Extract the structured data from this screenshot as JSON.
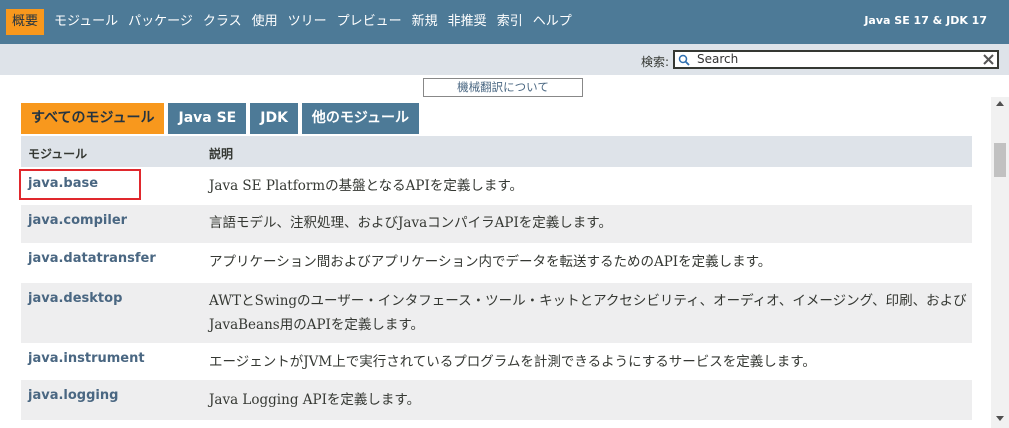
{
  "top_nav": {
    "items": [
      {
        "label": "概要",
        "active": true
      },
      {
        "label": "モジュール"
      },
      {
        "label": "パッケージ"
      },
      {
        "label": "クラス"
      },
      {
        "label": "使用"
      },
      {
        "label": "ツリー"
      },
      {
        "label": "プレビュー"
      },
      {
        "label": "新規"
      },
      {
        "label": "非推奨"
      },
      {
        "label": "索引"
      },
      {
        "label": "ヘルプ"
      }
    ],
    "version": "Java SE 17 & JDK 17"
  },
  "search": {
    "label": "検索:",
    "placeholder": "Search"
  },
  "translation_link": "機械翻訳について",
  "tabs": [
    {
      "label": "すべてのモジュール",
      "active": true
    },
    {
      "label": "Java SE"
    },
    {
      "label": "JDK"
    },
    {
      "label": "他のモジュール"
    }
  ],
  "table": {
    "headers": {
      "module": "モジュール",
      "description": "説明"
    },
    "rows": [
      {
        "module": "java.base",
        "description": "Java SE Platformの基盤となるAPIを定義します。"
      },
      {
        "module": "java.compiler",
        "description": "言語モデル、注釈処理、およびJavaコンパイラAPIを定義します。"
      },
      {
        "module": "java.datatransfer",
        "description": "アプリケーション間およびアプリケーション内でデータを転送するためのAPIを定義します。"
      },
      {
        "module": "java.desktop",
        "description": "AWTとSwingのユーザー・インタフェース・ツール・キットとアクセシビリティ、オーディオ、イメージング、印刷、およびJavaBeans用のAPIを定義します。"
      },
      {
        "module": "java.instrument",
        "description": "エージェントがJVM上で実行されているプログラムを計測できるようにするサービスを定義します。"
      },
      {
        "module": "java.logging",
        "description": "Java Logging APIを定義します。"
      }
    ]
  },
  "colors": {
    "nav_bg": "#4d7a97",
    "active_tab": "#f8981d",
    "subnav_bg": "#dee3e9",
    "link": "#4a6782",
    "highlight_box": "#e0282d"
  }
}
